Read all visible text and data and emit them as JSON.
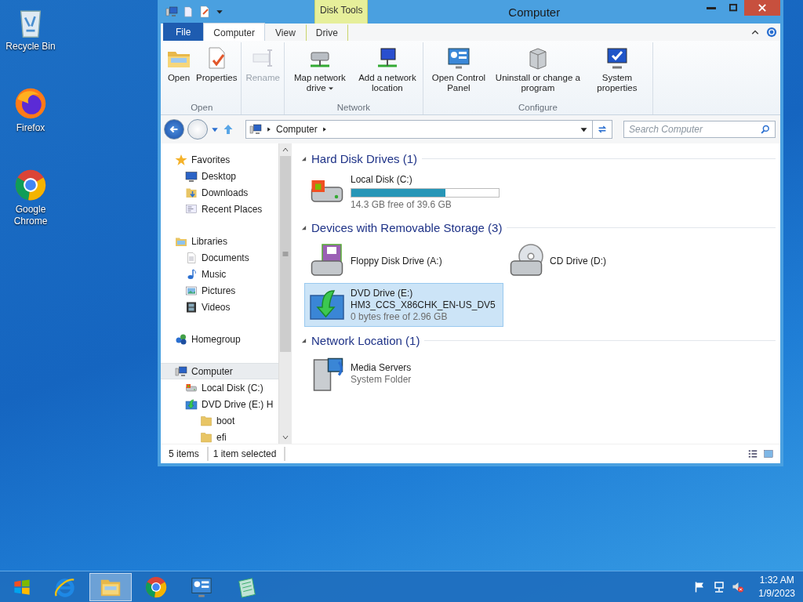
{
  "desktop_icons": [
    {
      "label": "Recycle Bin",
      "kind": "recycle"
    },
    {
      "label": "Firefox",
      "kind": "firefox"
    },
    {
      "label": "Google Chrome",
      "kind": "chrome"
    }
  ],
  "window": {
    "title": "Computer",
    "contextual_group": "Disk Tools",
    "tabs": [
      {
        "label": "File",
        "kind": "file",
        "selected": false
      },
      {
        "label": "Computer",
        "kind": "tab",
        "selected": true
      },
      {
        "label": "View",
        "kind": "tab",
        "selected": false
      },
      {
        "label": "Drive",
        "kind": "contextual",
        "selected": false
      }
    ],
    "ribbon_groups": [
      {
        "label": "Open",
        "buttons": [
          {
            "label": "Open",
            "kind": "open",
            "disabled": false
          },
          {
            "label": "Properties",
            "kind": "properties",
            "disabled": false
          }
        ]
      },
      {
        "buttons": [
          {
            "label": "Rename",
            "kind": "rename",
            "disabled": true
          }
        ]
      },
      {
        "label": "Network",
        "buttons": [
          {
            "label": "Map network drive",
            "kind": "map-drive",
            "disabled": false,
            "dropdown": true
          },
          {
            "label": "Add a network location",
            "kind": "add-location",
            "disabled": false
          }
        ]
      },
      {
        "label": "Configure",
        "buttons": [
          {
            "label": "Open Control Panel",
            "kind": "control-panel",
            "disabled": false
          },
          {
            "label": "Uninstall or change a program",
            "kind": "uninstall",
            "disabled": false
          },
          {
            "label": "System properties",
            "kind": "system",
            "disabled": false
          }
        ]
      }
    ],
    "address": {
      "crumbs": [
        "Computer"
      ]
    },
    "search": {
      "placeholder": "Search Computer"
    },
    "nav_pane": [
      {
        "label": "Favorites",
        "kind": "star",
        "selected": false,
        "children": [
          {
            "label": "Desktop",
            "kind": "desktop",
            "selected": false
          },
          {
            "label": "Downloads",
            "kind": "downloads",
            "selected": false
          },
          {
            "label": "Recent Places",
            "kind": "recent",
            "selected": false
          }
        ]
      },
      {
        "label": "Libraries",
        "kind": "libraries",
        "selected": false,
        "children": [
          {
            "label": "Documents",
            "kind": "documents",
            "selected": false
          },
          {
            "label": "Music",
            "kind": "music",
            "selected": false
          },
          {
            "label": "Pictures",
            "kind": "pictures",
            "selected": false
          },
          {
            "label": "Videos",
            "kind": "videos",
            "selected": false
          }
        ]
      },
      {
        "label": "Homegroup",
        "kind": "homegroup",
        "selected": false
      },
      {
        "label": "Computer",
        "kind": "computer",
        "selected": true,
        "children": [
          {
            "label": "Local Disk (C:)",
            "kind": "disk",
            "selected": false
          },
          {
            "label": "DVD Drive (E:) H",
            "kind": "dvd",
            "selected": false,
            "children": [
              {
                "label": "boot",
                "kind": "folder",
                "selected": false
              },
              {
                "label": "efi",
                "kind": "folder",
                "selected": false
              }
            ]
          }
        ]
      }
    ],
    "groups": [
      {
        "title": "Hard Disk Drives (1)",
        "items": [
          {
            "name": "Local Disk (C:)",
            "kind": "disk",
            "level": 0.64,
            "detail": "14.3 GB free of 39.6 GB",
            "selected": false
          }
        ]
      },
      {
        "title": "Devices with Removable Storage (3)",
        "items": [
          {
            "name": "Floppy Disk Drive (A:)",
            "kind": "floppy",
            "selected": false
          },
          {
            "name": "CD Drive (D:)",
            "kind": "cd",
            "selected": false
          },
          {
            "name": "DVD Drive (E:)",
            "subtitle": "HM3_CCS_X86CHK_EN-US_DV5",
            "kind": "dvd",
            "detail": "0 bytes free of 2.96 GB",
            "selected": true
          }
        ]
      },
      {
        "title": "Network Location (1)",
        "items": [
          {
            "name": "Media Servers",
            "kind": "media",
            "detail": "System Folder",
            "selected": false
          }
        ]
      }
    ],
    "status_bar": [
      "5 items",
      "1 item selected"
    ]
  },
  "taskbar": {
    "apps": [
      {
        "kind": "ie",
        "selected": false
      },
      {
        "kind": "explorer",
        "selected": true
      },
      {
        "kind": "chrome",
        "selected": false
      },
      {
        "kind": "control-panel",
        "selected": false
      },
      {
        "kind": "notepad",
        "selected": false
      }
    ],
    "time": "1:32 AM",
    "date": "1/9/2023"
  }
}
